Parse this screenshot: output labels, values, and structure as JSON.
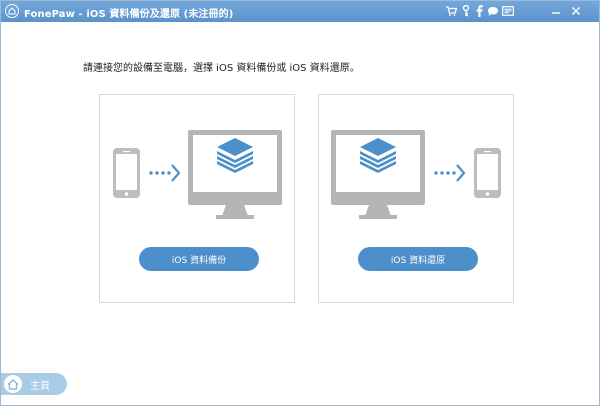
{
  "window": {
    "title": "FonePaw - iOS 資料備份及還原 (未注冊的)"
  },
  "toolbar": {
    "icons": [
      "cart-icon",
      "key-icon",
      "facebook-icon",
      "chat-icon",
      "feedback-icon",
      "minimize-icon",
      "close-icon"
    ]
  },
  "main": {
    "instruction": "請連接您的設備至電腦，選擇 iOS 資料備份或 iOS 資料還原。",
    "backup_label": "iOS 資料備份",
    "restore_label": "iOS 資料還原"
  },
  "footer": {
    "home_label": "主頁"
  },
  "colors": {
    "accent": "#4d8fcb",
    "device_gray": "#b5b5b5",
    "layer_blue": "#4d8fcb",
    "titlebar": "#5b92ca"
  }
}
